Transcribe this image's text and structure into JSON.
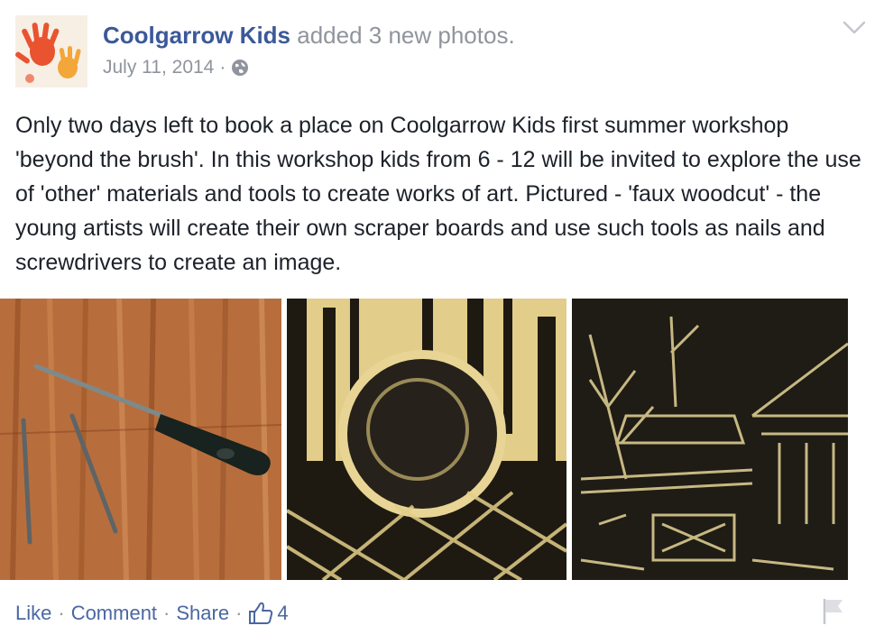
{
  "post": {
    "page_name": "Coolgarrow Kids",
    "action_text": "added 3 new photos.",
    "date": "July 11, 2014",
    "separator": "·",
    "privacy_icon": "globe-icon",
    "options_icon": "chevron-down-icon",
    "text": "Only two days left to book a place on Coolgarrow Kids first summer workshop 'beyond the brush'. In this workshop kids from 6 - 12 will be invited to explore the use of 'other' materials and tools to create works of art. Pictured - 'faux woodcut' - the young artists will create their own scraper boards and use such tools as nails and screwdrivers to create an image.",
    "photos": [
      "screwdriver-and-nails-photo",
      "scraperboard-ball-photo",
      "scraperboard-house-photo"
    ]
  },
  "footer": {
    "like": "Like",
    "comment": "Comment",
    "share": "Share",
    "sep": "·",
    "like_count": "4",
    "like_icon": "thumbs-up-icon",
    "report_icon": "flag-icon"
  },
  "colors": {
    "link": "#3b5998",
    "meta": "#90949c",
    "text": "#1d2129",
    "footer_link": "#4b67a1"
  }
}
